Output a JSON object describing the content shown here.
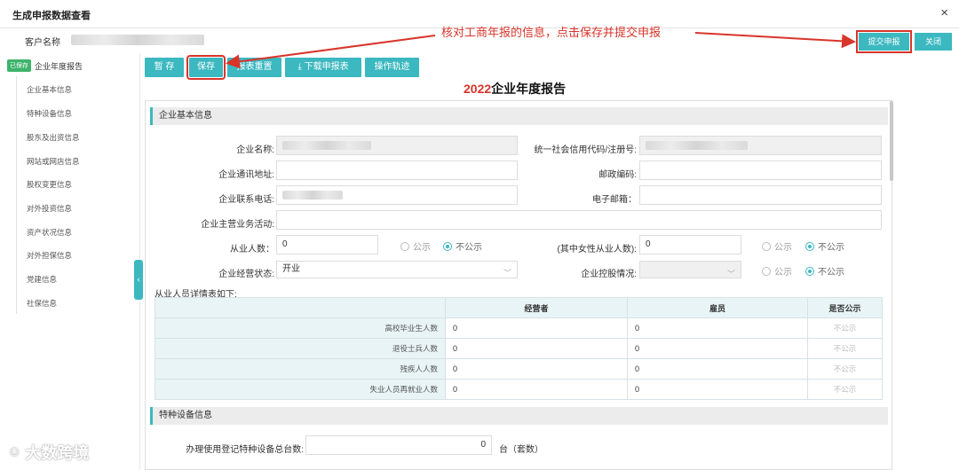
{
  "window": {
    "title": "生成申报数据查看",
    "close": "×"
  },
  "customer": {
    "label": "客户名称"
  },
  "sidebar": {
    "badge": "已保存",
    "root": "企业年度报告",
    "items": [
      "企业基本信息",
      "特种设备信息",
      "股东及出资信息",
      "网站或网店信息",
      "股权变更信息",
      "对外投资信息",
      "资产状况信息",
      "对外担保信息",
      "党建信息",
      "社保信息"
    ],
    "collapse": "‹"
  },
  "toolbar": {
    "temp_save": "暂 存",
    "save": "保存",
    "reset": "报表重置",
    "download": "下载申报表",
    "download_icon": "⤓",
    "history": "操作轨迹"
  },
  "top_actions": {
    "submit": "提交申报",
    "close": "关闭"
  },
  "annotation": "核对工商年报的信息，点击保存并提交申报",
  "report": {
    "year": "2022",
    "title": "企业年度报告"
  },
  "basic": {
    "section": "企业基本信息",
    "name_label": "企业名称:",
    "credit_label": "统一社会信用代码/注册号:",
    "address_label": "企业通讯地址:",
    "postal_label": "邮政编码:",
    "phone_label": "企业联系电话:",
    "email_label": "电子邮箱：",
    "business_label": "企业主营业务活动:",
    "employees_label": "从业人数：",
    "employees_value": "0",
    "female_label": "(其中女性从业人数):",
    "female_value": "0",
    "public": "公示",
    "not_public": "不公示",
    "status_label": "企业经营状态:",
    "status_value": "开业",
    "holding_label": "企业控股情况:",
    "detail_title": "从业人员详情表如下:",
    "table": {
      "headers": [
        "",
        "经营者",
        "雇员",
        "是否公示"
      ],
      "rows": [
        {
          "label": "高校毕业生人数",
          "operator": "0",
          "employee": "0",
          "public": "不公示"
        },
        {
          "label": "退役士兵人数",
          "operator": "0",
          "employee": "0",
          "public": "不公示"
        },
        {
          "label": "残疾人人数",
          "operator": "0",
          "employee": "0",
          "public": "不公示"
        },
        {
          "label": "失业人员再就业人数",
          "operator": "0",
          "employee": "0",
          "public": "不公示"
        }
      ]
    }
  },
  "equipment": {
    "section": "特种设备信息",
    "count_label": "办理使用登记特种设备总台数:",
    "count_value": "0",
    "unit": "台（套数）"
  },
  "watermark": "大数跨境"
}
